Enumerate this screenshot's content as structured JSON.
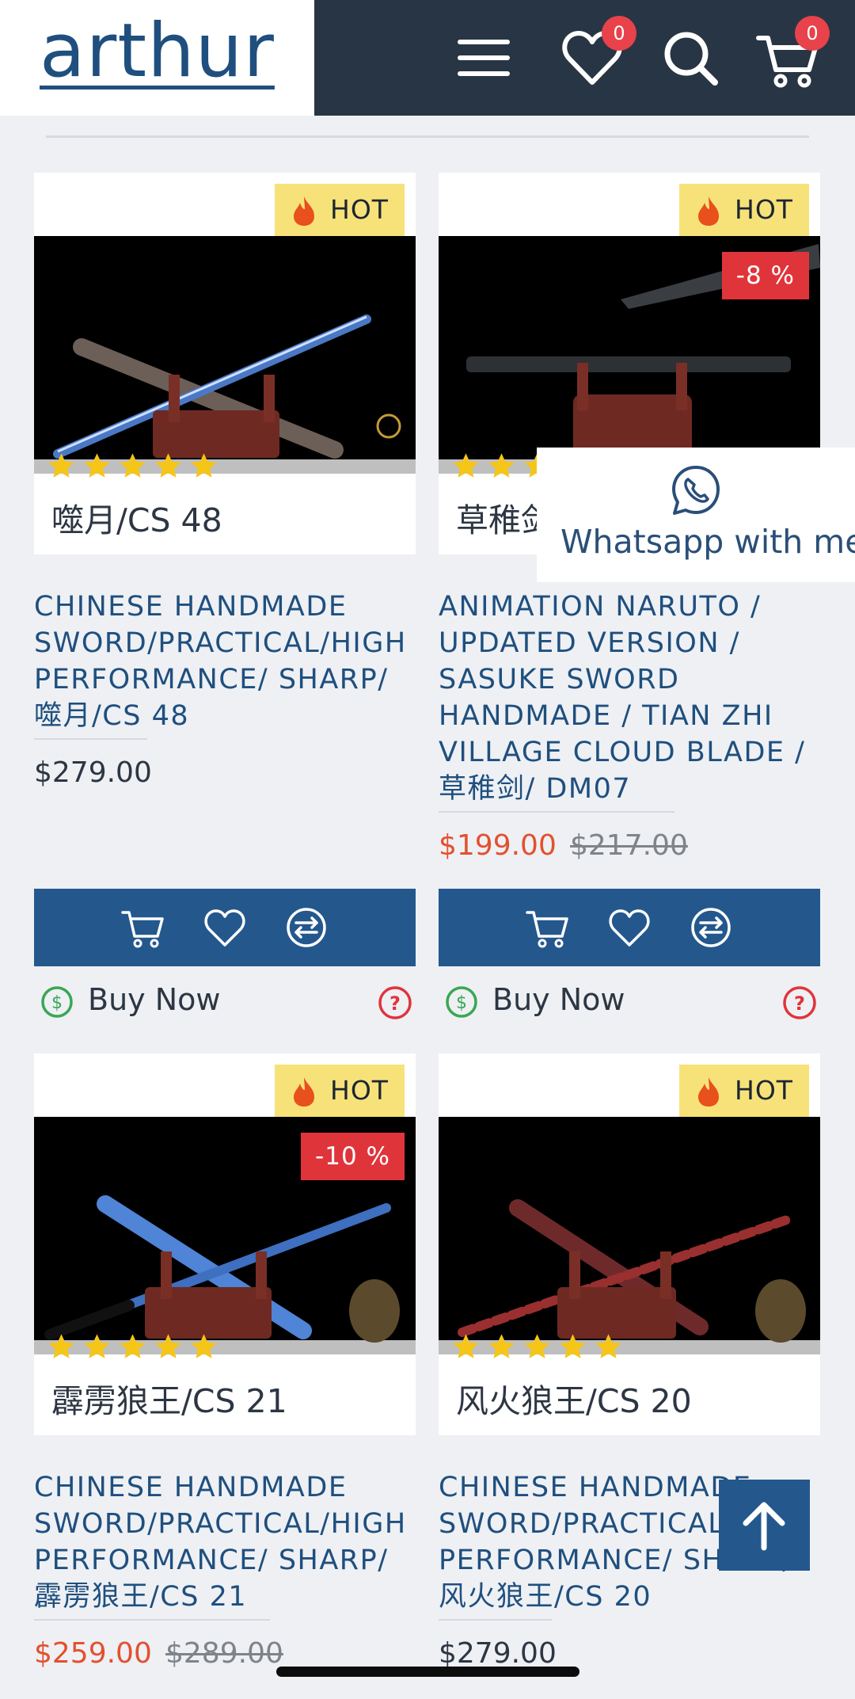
{
  "header": {
    "logo": "arthur",
    "wishlist_count": "0",
    "cart_count": "0"
  },
  "products": [
    {
      "badge": "HOT",
      "discount": "",
      "rating": 5,
      "chinese_name": "噬月/CS 48",
      "title_lines": [
        "CHINESE HANDMADE",
        "SWORD/PRACTICAL/HIGH",
        "PERFORMANCE/ SHARP/",
        "噬月/CS 48"
      ],
      "price": "$279.00",
      "old_price": "",
      "buy_now": "Buy Now"
    },
    {
      "badge": "HOT",
      "discount": "-8 %",
      "rating": 5,
      "chinese_name": "草稚剑/DM07",
      "title_lines": [
        "ANIMATION NARUTO /",
        "UPDATED VERSION /",
        "SASUKE SWORD",
        "HANDMADE / TIAN ZHI",
        "VILLAGE CLOUD BLADE /",
        "草稚剑/ DM07"
      ],
      "price": "$199.00",
      "old_price": "$217.00",
      "buy_now": "Buy Now"
    },
    {
      "badge": "HOT",
      "discount": "-10 %",
      "rating": 5,
      "chinese_name": "霹雳狼王/CS 21",
      "title_lines": [
        "CHINESE HANDMADE",
        "SWORD/PRACTICAL/HIGH",
        "PERFORMANCE/ SHARP/",
        "霹雳狼王/CS 21"
      ],
      "price": "$259.00",
      "old_price": "$289.00",
      "buy_now": ""
    },
    {
      "badge": "HOT",
      "discount": "",
      "rating": 5,
      "chinese_name": "风火狼王/CS 20",
      "title_lines": [
        "CHINESE HANDMADE",
        "SWORD/PRACTICAL/HIGH",
        "PERFORMANCE/ SHARP/",
        "风火狼王/CS 20"
      ],
      "price": "$279.00",
      "old_price": "",
      "buy_now": ""
    }
  ],
  "whatsapp": {
    "label": "Whatsapp with me"
  },
  "colors": {
    "header_bg": "#283544",
    "brand_blue": "#24588d",
    "title_blue": "#1f4f7e",
    "hot_badge": "#f7e27a",
    "discount_badge": "#e0343b",
    "sale_price": "#e2512f",
    "star": "#f5c518"
  }
}
